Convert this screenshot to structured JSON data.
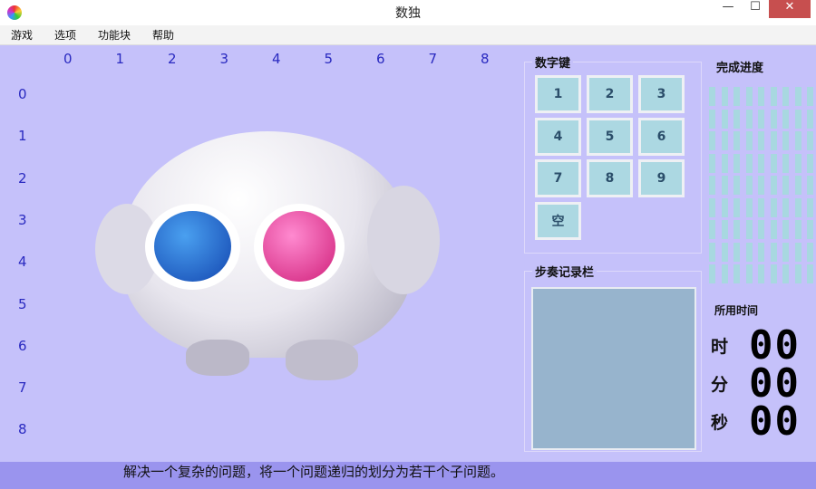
{
  "window": {
    "title": "数独",
    "minimize": "—",
    "maximize": "☐",
    "close": "✕"
  },
  "menu": [
    "游戏",
    "选项",
    "功能块",
    "帮助"
  ],
  "columns": [
    "0",
    "1",
    "2",
    "3",
    "4",
    "5",
    "6",
    "7",
    "8"
  ],
  "rows": [
    "0",
    "1",
    "2",
    "3",
    "4",
    "5",
    "6",
    "7",
    "8"
  ],
  "keypad": {
    "title": "数字键",
    "keys": [
      "1",
      "2",
      "3",
      "4",
      "5",
      "6",
      "7",
      "8",
      "9",
      "空"
    ]
  },
  "progress": {
    "title": "完成进度",
    "value": 0
  },
  "log": {
    "title": "步奏记录栏"
  },
  "timer": {
    "title": "所用时间",
    "hour_label": "时",
    "minute_label": "分",
    "second_label": "秒",
    "hours": "00",
    "minutes": "00",
    "seconds": "00"
  },
  "status": "解决一个复杂的问题，将一个问题递归的划分为若干个子问题。",
  "colors": {
    "background": "#c5c1fa",
    "key": "#acd8e2",
    "status_bar": "#9a94ee"
  }
}
